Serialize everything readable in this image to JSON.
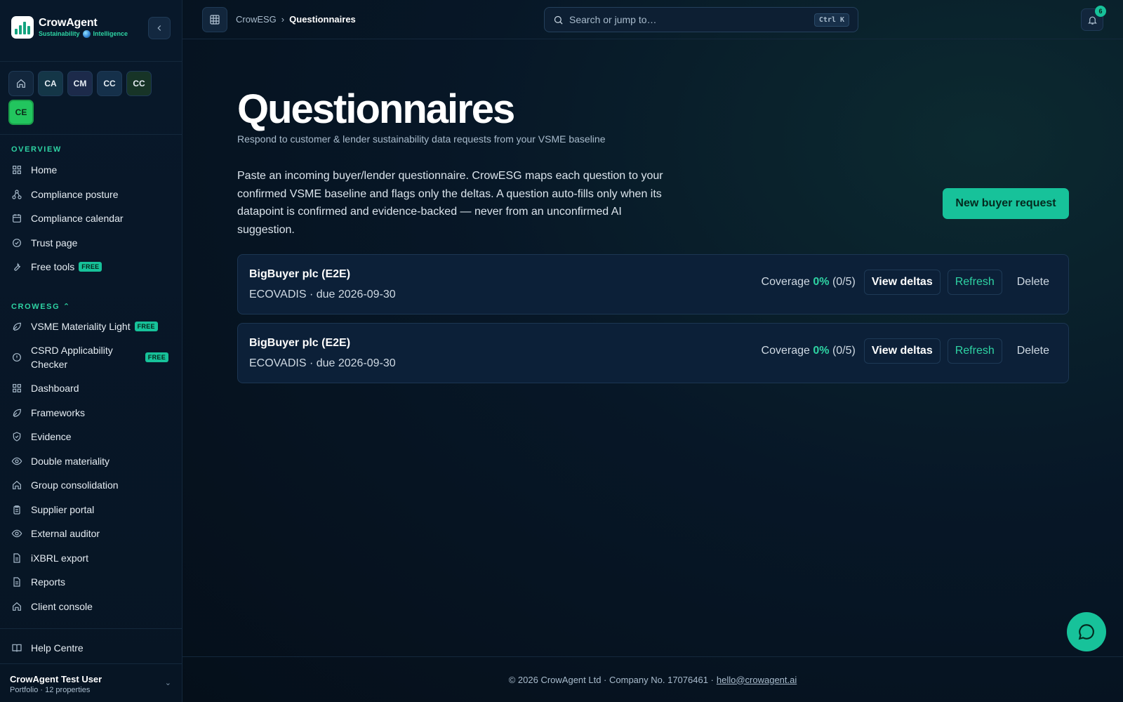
{
  "brand": {
    "name": "CrowAgent",
    "tag_left": "Sustainability",
    "tag_right": "Intelligence"
  },
  "workspaces": [
    "CA",
    "CM",
    "CC",
    "CC",
    "CE"
  ],
  "sidebar": {
    "overview_label": "OVERVIEW",
    "overview_items": [
      {
        "label": "Home"
      },
      {
        "label": "Compliance posture"
      },
      {
        "label": "Compliance calendar"
      },
      {
        "label": "Trust page"
      },
      {
        "label": "Free tools",
        "badge": "FREE"
      }
    ],
    "crowesg_label": "CROWESG ⌃",
    "crowesg_items": [
      {
        "label": "VSME Materiality Light",
        "badge": "FREE"
      },
      {
        "label": "CSRD Applicability Checker",
        "badge": "FREE"
      },
      {
        "label": "Dashboard"
      },
      {
        "label": "Frameworks"
      },
      {
        "label": "Evidence"
      },
      {
        "label": "Double materiality"
      },
      {
        "label": "Group consolidation"
      },
      {
        "label": "Supplier portal"
      },
      {
        "label": "External auditor"
      },
      {
        "label": "iXBRL export"
      },
      {
        "label": "Reports"
      },
      {
        "label": "Client console"
      }
    ],
    "help": "Help Centre",
    "user": {
      "name": "CrowAgent Test User",
      "sub": "Portfolio · 12 properties"
    }
  },
  "topbar": {
    "crumb_root": "CrowESG",
    "crumb_sep": "›",
    "crumb_current": "Questionnaires",
    "search_placeholder": "Search or jump to…",
    "search_kbd": "Ctrl K",
    "notifications": "6"
  },
  "page": {
    "title": "Questionnaires",
    "subtitle": "Respond to customer & lender sustainability data requests from your VSME baseline",
    "intro": "Paste an incoming buyer/lender questionnaire. CrowESG maps each question to your confirmed VSME baseline and flags only the deltas. A question auto-fills only when its datapoint is confirmed and evidence-backed — never from an unconfirmed AI suggestion.",
    "new_button": "New buyer request"
  },
  "requests": [
    {
      "title": "BigBuyer plc (E2E)",
      "meta": "ECOVADIS · due 2026-09-30",
      "coverage_label": "Coverage",
      "coverage_pct": "0%",
      "coverage_count": "(0/5)",
      "view": "View deltas",
      "refresh": "Refresh",
      "delete": "Delete"
    },
    {
      "title": "BigBuyer plc (E2E)",
      "meta": "ECOVADIS · due 2026-09-30",
      "coverage_label": "Coverage",
      "coverage_pct": "0%",
      "coverage_count": "(0/5)",
      "view": "View deltas",
      "refresh": "Refresh",
      "delete": "Delete"
    }
  ],
  "footer": {
    "text": "© 2026 CrowAgent Ltd · Company No. 17076461 ·",
    "email": "hello@crowagent.ai"
  }
}
